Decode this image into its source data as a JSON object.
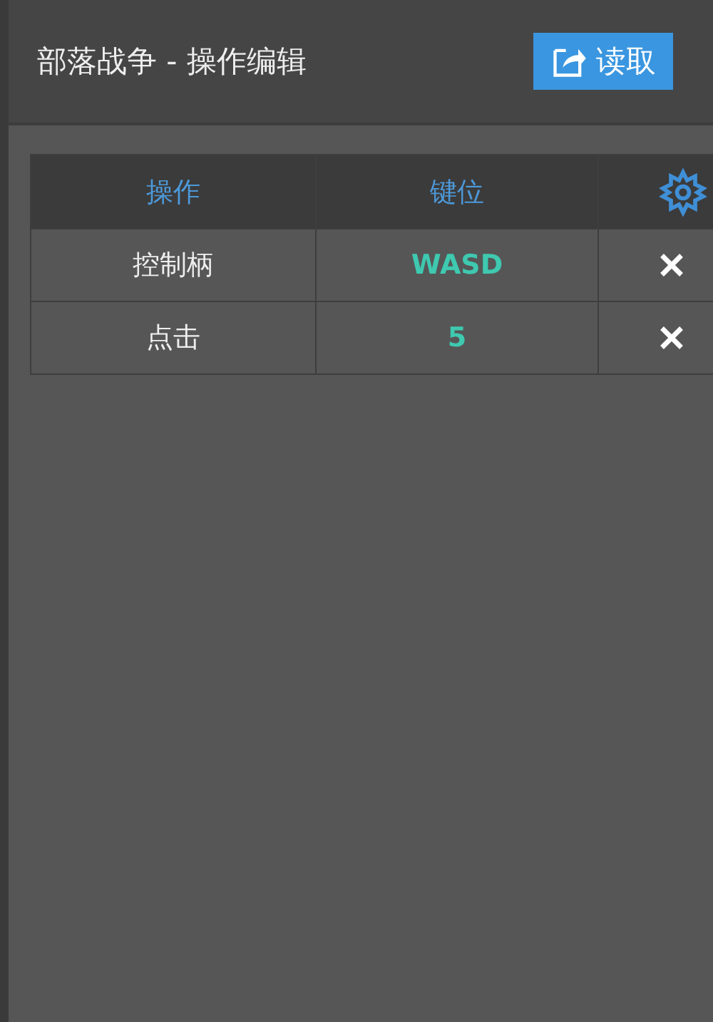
{
  "header": {
    "title": "部落战争 - 操作编辑",
    "button": "读取"
  },
  "table": {
    "columns": [
      "操作",
      "键位"
    ],
    "rows": [
      {
        "action": "控制柄",
        "key": "WASD"
      },
      {
        "action": "点击",
        "key": "5"
      }
    ]
  }
}
